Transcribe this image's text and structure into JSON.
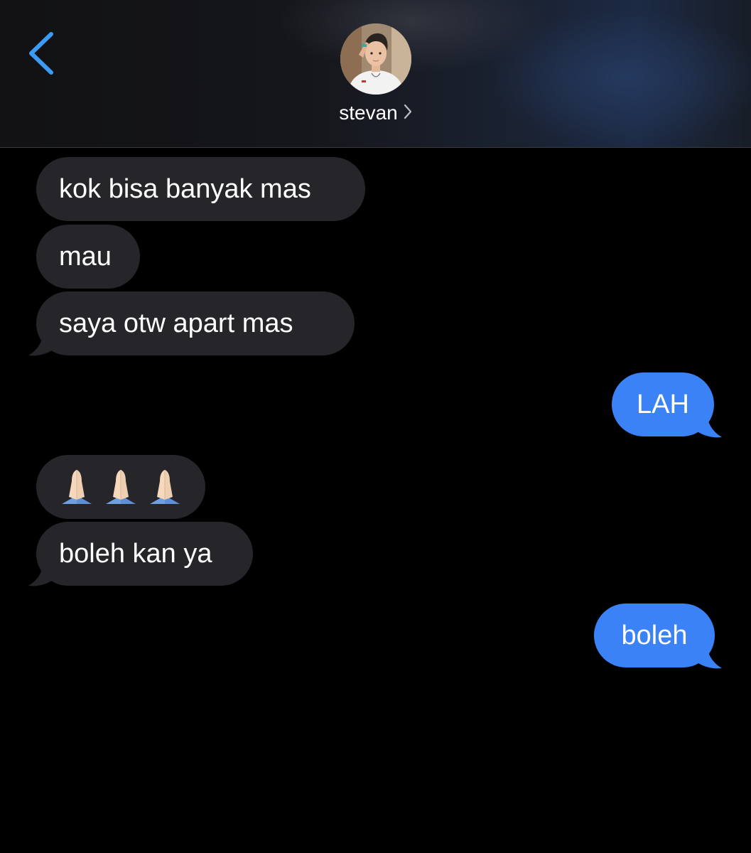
{
  "header": {
    "contact_name": "stevan",
    "back_color": "#3b9cf5"
  },
  "messages": [
    {
      "direction": "incoming",
      "text": "kok bisa banyak mas"
    },
    {
      "direction": "incoming",
      "text": "mau"
    },
    {
      "direction": "incoming",
      "text": "saya otw apart mas"
    },
    {
      "direction": "outgoing",
      "text": "LAH"
    },
    {
      "direction": "incoming",
      "emoji": "folded-hands",
      "count": 3
    },
    {
      "direction": "incoming",
      "text": "boleh kan ya"
    },
    {
      "direction": "outgoing",
      "text": "boleh"
    }
  ],
  "colors": {
    "incoming_bubble": "#26252a",
    "outgoing_bubble": "#3b82f6",
    "background": "#000000"
  }
}
